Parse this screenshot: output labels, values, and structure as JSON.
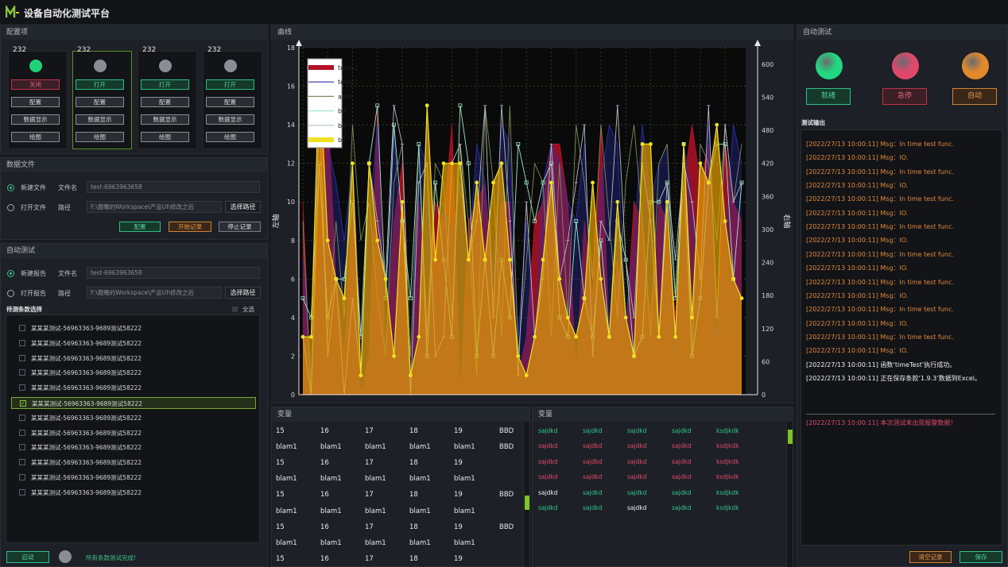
{
  "app": {
    "title": "设备自动化测试平台",
    "logo": "M"
  },
  "config": {
    "header": "配置项",
    "cards": [
      {
        "num": "232",
        "dot": "#1fd27a",
        "btn": "关闭",
        "style": "red"
      },
      {
        "num": "232",
        "dot": "#8a8d92",
        "btn": "打开",
        "style": "green"
      },
      {
        "num": "232",
        "dot": "#8a8d92",
        "btn": "打开",
        "style": "green"
      },
      {
        "num": "232",
        "dot": "#8a8d92",
        "btn": "打开",
        "style": "green"
      }
    ],
    "btn_config": "配置",
    "btn_data": "数据显示",
    "btn_plot": "绘图"
  },
  "datafile": {
    "header": "数据文件",
    "new_label": "新建文件",
    "file_label": "文件名",
    "file_value": "test-6963963658",
    "open_label": "打开文件",
    "path_label": "路径",
    "path_value": "F:\\鹿瞻的Workspace\\产品UI\\修改之后",
    "choose": "选择路径",
    "btn_config": "配置",
    "btn_start": "开始记录",
    "btn_stop": "停止记录"
  },
  "autotest": {
    "header": "自动测试",
    "new_label": "新建报告",
    "file_label": "文件名",
    "file_value": "test-6963963658",
    "open_label": "打开报告",
    "path_label": "路径",
    "path_value": "F:\\鹿瞻的Workspace\\产品UI\\修改之后",
    "choose": "选择路径",
    "items_header": "待测条款选择",
    "all": "全选",
    "items": [
      "某某某测试-56963363-9689测试58222",
      "某某某测试-56963363-9689测试58222",
      "某某某测试-56963363-9689测试58222",
      "某某某测试-56963363-9689测试58222",
      "某某某测试-56963363-9689测试58222",
      "某某某测试-56963363-9689测试58222",
      "某某某测试-56963363-9689测试58222",
      "某某某测试-56963363-9689测试58222",
      "某某某测试-56963363-9689测试58222",
      "某某某测试-56963363-9689测试58222",
      "某某某测试-56963363-9689测试58222",
      "某某某测试-56963363-9689测试58222"
    ],
    "selected_index": 5,
    "btn_start": "启动",
    "status": "所有条款测试完成!"
  },
  "curve": {
    "header": "曲线"
  },
  "chart_data": {
    "type": "area",
    "ylabel": "左轴",
    "y2label": "右轴",
    "ylim": [
      0,
      18
    ],
    "y2lim": [
      0,
      630
    ],
    "yticks": [
      0,
      2,
      4,
      6,
      8,
      10,
      12,
      14,
      16,
      18
    ],
    "y2ticks": [
      0,
      60,
      120,
      180,
      240,
      300,
      360,
      420,
      480,
      540,
      600
    ],
    "legend": [
      "temp1",
      "temp2",
      "asfd",
      "b3",
      "b6",
      "b7"
    ],
    "series": [
      {
        "name": "temp1",
        "color": "#b01227",
        "values": [
          10,
          0,
          14,
          15,
          6,
          2,
          10,
          0,
          2,
          15,
          2,
          9,
          12,
          0,
          10,
          4,
          10,
          9,
          14,
          0,
          9,
          10,
          11,
          5,
          10,
          10,
          1,
          3,
          9,
          10,
          13,
          13,
          10,
          1,
          9,
          5,
          14,
          3,
          7,
          3,
          10,
          9,
          4,
          10,
          9,
          4,
          11,
          14,
          11,
          13,
          3,
          13,
          10,
          9
        ]
      },
      {
        "name": "temp2",
        "color": "#2b2fa7",
        "values": [
          7,
          1,
          5,
          13,
          11,
          8,
          12,
          3,
          9,
          14,
          2,
          14,
          6,
          0,
          13,
          12,
          4,
          10,
          8,
          11,
          7,
          13,
          11,
          6,
          14,
          13,
          3,
          9,
          2,
          11,
          13,
          12,
          10,
          9,
          13,
          4,
          11,
          14,
          13,
          4,
          8,
          14,
          10,
          12,
          13,
          2,
          13,
          10,
          4,
          14,
          3,
          8,
          14,
          12
        ]
      },
      {
        "name": "asfd",
        "color": "#7d8b5a",
        "values": [
          9,
          0,
          12,
          3,
          9,
          4,
          14,
          8,
          10,
          5,
          2,
          11,
          13,
          2,
          13,
          3,
          12,
          11,
          4,
          13,
          9,
          1,
          15,
          11,
          3,
          15,
          2,
          7,
          12,
          11,
          3,
          12,
          4,
          14,
          11,
          6,
          14,
          9,
          4,
          11,
          14,
          9,
          3,
          12,
          13,
          5,
          11,
          2,
          13,
          12,
          8,
          14,
          10,
          13
        ]
      },
      {
        "name": "b3",
        "color": "#9ee7c8",
        "values": [
          5,
          4,
          12,
          4,
          6,
          6,
          10,
          3,
          12,
          15,
          5,
          14,
          9,
          5,
          13,
          2,
          11,
          7,
          3,
          15,
          12,
          2,
          7,
          2,
          7,
          4,
          13,
          11,
          9,
          11,
          12,
          4,
          3,
          9,
          5,
          3,
          8,
          3,
          9,
          7,
          2,
          3,
          10,
          10,
          11,
          5,
          13,
          2,
          5,
          11,
          13,
          13,
          6,
          11
        ]
      },
      {
        "name": "b6",
        "color": "#b7bbc4",
        "values": [
          3,
          0,
          15,
          2,
          6,
          0,
          5,
          1,
          12,
          9,
          6,
          15,
          13,
          0,
          11,
          12,
          2,
          3,
          12,
          13,
          7,
          9,
          15,
          4,
          15,
          9,
          1,
          10,
          3,
          6,
          13,
          6,
          8,
          11,
          14,
          2,
          9,
          8,
          15,
          7,
          4,
          12,
          9,
          3,
          11,
          7,
          12,
          10,
          6,
          15,
          4,
          14,
          10,
          11
        ]
      },
      {
        "name": "b7",
        "color": "#f0e223",
        "values": [
          3,
          3,
          17,
          8,
          6,
          5,
          12,
          1,
          12,
          8,
          6,
          2,
          10,
          1,
          3,
          15,
          7,
          12,
          12,
          12,
          7,
          11,
          7,
          11,
          12,
          7,
          2,
          1,
          3,
          7,
          11,
          6,
          4,
          3,
          5,
          11,
          6,
          3,
          10,
          4,
          2,
          13,
          13,
          3,
          10,
          3,
          13,
          4,
          12,
          11,
          14,
          9,
          6,
          5
        ]
      }
    ]
  },
  "vars1": {
    "header": "变量",
    "rows": [
      [
        "15",
        "16",
        "17",
        "18",
        "19",
        "BBD"
      ],
      [
        "blam1",
        "blam1",
        "blam1",
        "blam1",
        "blam1",
        "BBD"
      ],
      [
        "15",
        "16",
        "17",
        "18",
        "19",
        ""
      ],
      [
        "blam1",
        "blam1",
        "blam1",
        "blam1",
        "blam1",
        ""
      ],
      [
        "15",
        "16",
        "17",
        "18",
        "19",
        "BBD"
      ],
      [
        "blam1",
        "blam1",
        "blam1",
        "blam1",
        "blam1",
        ""
      ],
      [
        "15",
        "16",
        "17",
        "18",
        "19",
        "BBD"
      ],
      [
        "blam1",
        "blam1",
        "blam1",
        "blam1",
        "blam1",
        ""
      ],
      [
        "15",
        "16",
        "17",
        "18",
        "19",
        ""
      ]
    ]
  },
  "vars2": {
    "header": "变量",
    "rows": [
      [
        [
          "sajdkd",
          "g"
        ],
        [
          "sajdkd",
          "g"
        ],
        [
          "sajdkd",
          "g"
        ],
        [
          "sajdkd",
          "g"
        ],
        [
          "ksdjkdk",
          "g"
        ]
      ],
      [
        [
          "sajdkd",
          "r"
        ],
        [
          "sajdkd",
          "r"
        ],
        [
          "sajdkd",
          "r"
        ],
        [
          "sajdkd",
          "r"
        ],
        [
          "ksdjkdk",
          "r"
        ]
      ],
      [
        [
          "sajdkd",
          "r"
        ],
        [
          "sajdkd",
          "r"
        ],
        [
          "sajdkd",
          "r"
        ],
        [
          "sajdkd",
          "r"
        ],
        [
          "ksdjkdk",
          "r"
        ]
      ],
      [
        [
          "sajdkd",
          "r"
        ],
        [
          "sajdkd",
          "r"
        ],
        [
          "sajdkd",
          "r"
        ],
        [
          "sajdkd",
          "r"
        ],
        [
          "ksdjkdk",
          "r"
        ]
      ],
      [
        [
          "sajdkd",
          "w"
        ],
        [
          "sajdkd",
          "g"
        ],
        [
          "sajdkd",
          "g"
        ],
        [
          "sajdkd",
          "g"
        ],
        [
          "ksdjkdk",
          "g"
        ]
      ],
      [
        [
          "sajdkd",
          "g"
        ],
        [
          "sajdkd",
          "g"
        ],
        [
          "sajdkd",
          "w"
        ],
        [
          "sajdkd",
          "g"
        ],
        [
          "ksdjkdk",
          "g"
        ]
      ]
    ]
  },
  "right": {
    "header": "自动测试",
    "lights": [
      {
        "color": "#21d782",
        "label": "就绪",
        "style": "green"
      },
      {
        "color": "#e0486b",
        "label": "急停",
        "style": "red"
      },
      {
        "color": "#e28a2a",
        "label": "自动",
        "style": "orange"
      }
    ],
    "out_header": "测试输出",
    "log": [
      [
        "[2022/27/13 10:00:11] Msg：In time test func.",
        "o"
      ],
      [
        "[2022/27/13 10:00:11] Msg：IO.",
        "o"
      ],
      [
        "[2022/27/13 10:00:11] Msg：In time test func.",
        "o"
      ],
      [
        "[2022/27/13 10:00:11] Msg：IO.",
        "o"
      ],
      [
        "[2022/27/13 10:00:11] Msg：In time test func.",
        "o"
      ],
      [
        "[2022/27/13 10:00:11] Msg：IO.",
        "o"
      ],
      [
        "[2022/27/13 10:00:11] Msg：In time test func.",
        "o"
      ],
      [
        "[2022/27/13 10:00:11] Msg：IO.",
        "o"
      ],
      [
        "[2022/27/13 10:00:11] Msg：In time test func.",
        "o"
      ],
      [
        "[2022/27/13 10:00:11] Msg：IO.",
        "o"
      ],
      [
        "[2022/27/13 10:00:11] Msg：In time test func.",
        "o"
      ],
      [
        "[2022/27/13 10:00:11] Msg：IO.",
        "o"
      ],
      [
        "[2022/27/13 10:00:11] Msg：In time test func.",
        "o"
      ],
      [
        "[2022/27/13 10:00:11] Msg：IO.",
        "o"
      ],
      [
        "[2022/27/13 10:00:11] Msg：In time test func.",
        "o"
      ],
      [
        "[2022/27/13 10:00:11] Msg：IO.",
        "o"
      ],
      [
        "[2022/27/13 10:00:11] 函数‘timeTest’执行成功。",
        "w"
      ],
      [
        "[2022/27/13 10:00:11] 正在保存条款‘1.9.3’数据到Excel。",
        "w"
      ],
      [
        "[2022/27/13 10:00:11] 本次测试未出现报警数据！",
        "r"
      ]
    ],
    "btn_clear": "清空记录",
    "btn_save": "保存"
  }
}
